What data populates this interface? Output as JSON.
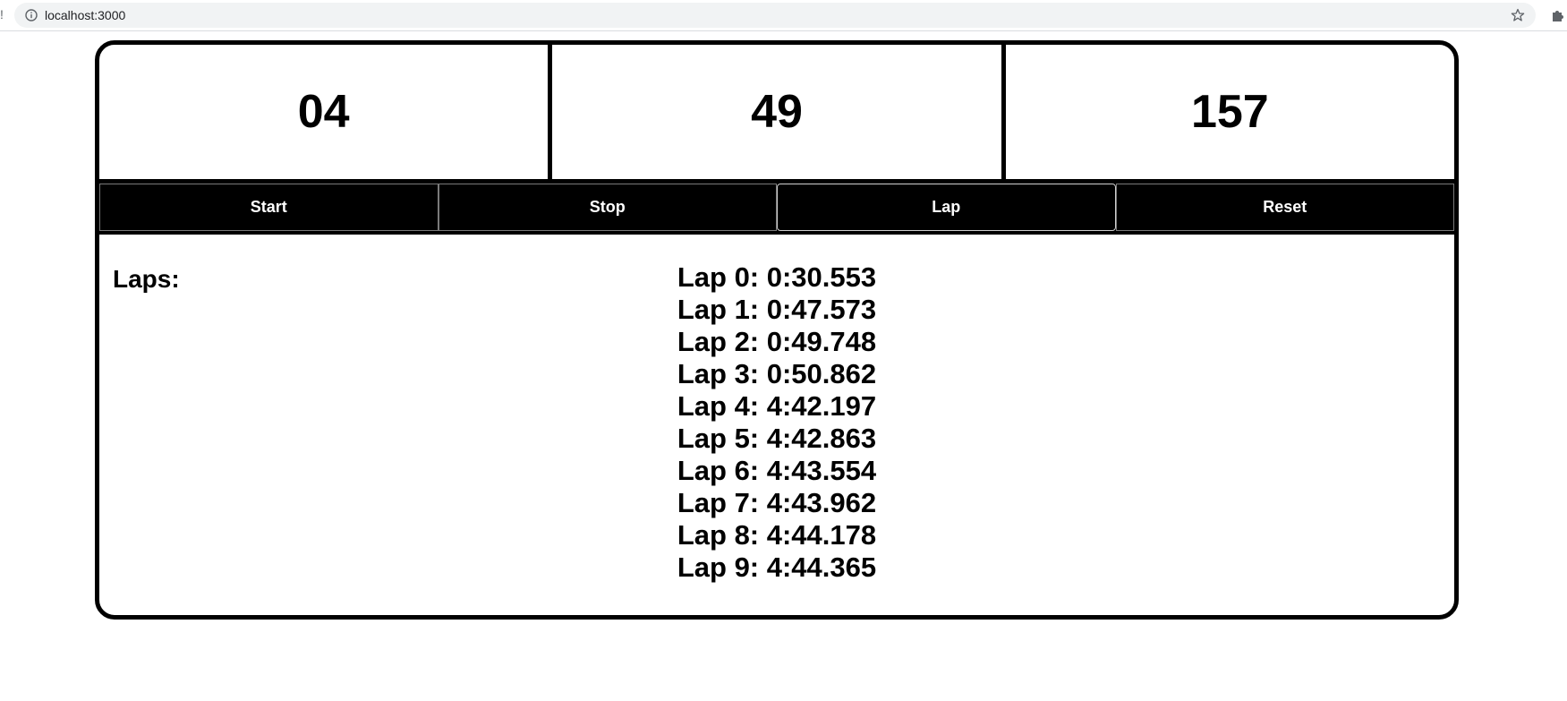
{
  "browser": {
    "url": "localhost:3000",
    "icons": [
      "info-icon",
      "star-icon",
      "extension-puzzle-icon"
    ]
  },
  "stopwatch": {
    "minutes": "04",
    "seconds": "49",
    "milliseconds": "157"
  },
  "controls": {
    "start_label": "Start",
    "stop_label": "Stop",
    "lap_label": "Lap",
    "reset_label": "Reset"
  },
  "laps": {
    "heading": "Laps:",
    "items": [
      "Lap 0: 0:30.553",
      "Lap 1: 0:47.573",
      "Lap 2: 0:49.748",
      "Lap 3: 0:50.862",
      "Lap 4: 4:42.197",
      "Lap 5: 4:42.863",
      "Lap 6: 4:43.554",
      "Lap 7: 4:43.962",
      "Lap 8: 4:44.178",
      "Lap 9: 4:44.365"
    ]
  },
  "colors": {
    "frame": "#000000",
    "background": "#ffffff",
    "button_bg": "#000000",
    "button_text": "#ffffff",
    "address_bar": "#f1f3f4"
  }
}
